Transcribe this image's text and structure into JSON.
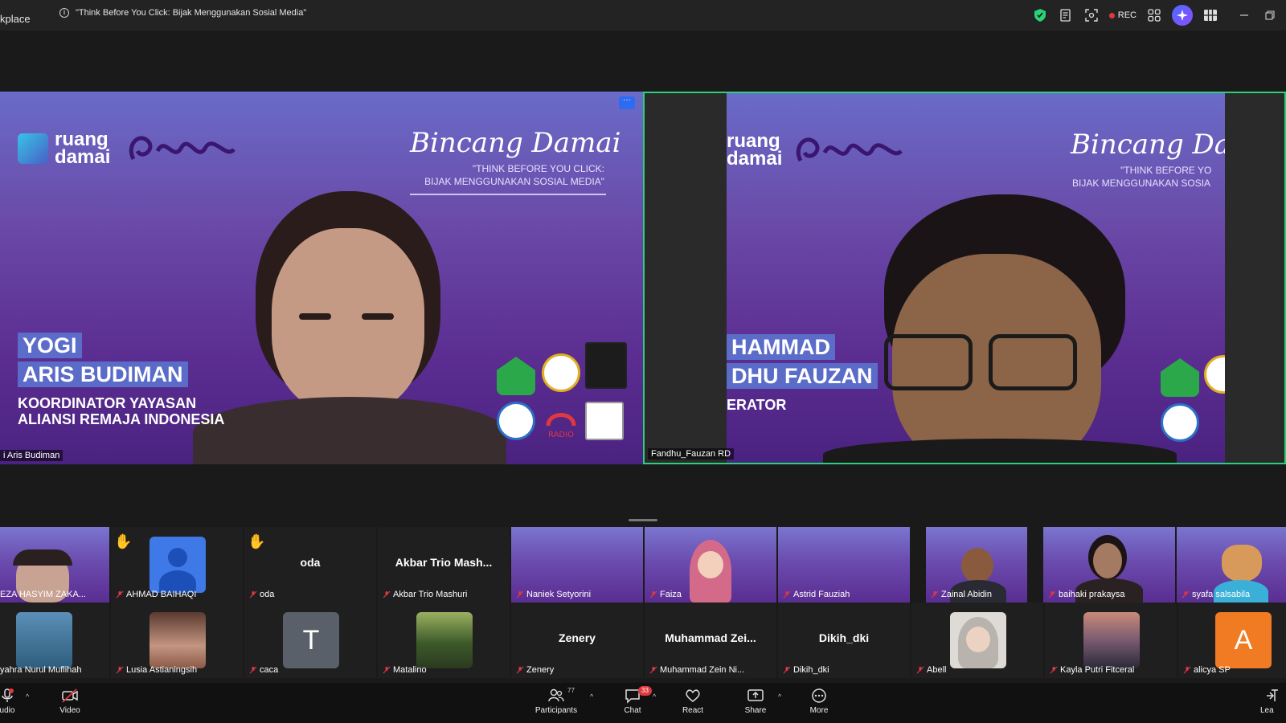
{
  "window": {
    "app_name": "kplace",
    "meeting_title": "\"Think Before You Click: Bijak Menggunakan Sosial Media\"",
    "rec_label": "REC"
  },
  "main": {
    "left_tile": {
      "brand": "ruang damai",
      "script_title": "Bincang Damai",
      "subtitle_line1": "\"THINK BEFORE YOU CLICK:",
      "subtitle_line2": "BIJAK MENGGUNAKAN SOSIAL MEDIA\"",
      "name_line1": "YOGI",
      "name_line2": "ARIS BUDIMAN",
      "role_line1": "KOORDINATOR YAYASAN",
      "role_line2": "ALIANSI REMAJA INDONESIA",
      "participant_label": "i Aris Budiman"
    },
    "right_tile": {
      "brand": "ruang damai",
      "script_title": "Bincang Da",
      "subtitle_line1": "\"THINK BEFORE YO",
      "subtitle_line2": "BIJAK MENGGUNAKAN SOSIA",
      "name_line1": "HAMMAD",
      "name_line2": "DHU FAUZAN",
      "role_line1": "ERATOR",
      "participant_label": "Fandhu_Fauzan RD"
    }
  },
  "gallery": {
    "row1": [
      {
        "label": "EZA HASYIM ZAKA...",
        "kind": "video"
      },
      {
        "label": "AHMAD BAIHAQI",
        "kind": "avatar",
        "hand": true
      },
      {
        "label": "oda",
        "center": "oda",
        "kind": "name",
        "hand": true
      },
      {
        "label": "Akbar Trio Mashuri",
        "center": "Akbar Trio Mash...",
        "kind": "name"
      },
      {
        "label": "Naniek Setyorini",
        "kind": "purple"
      },
      {
        "label": "Faiza",
        "kind": "purple"
      },
      {
        "label": "Astrid Fauziah",
        "kind": "purple"
      },
      {
        "label": "Zainal Abidin",
        "kind": "video"
      },
      {
        "label": "baihaki prakaysa",
        "kind": "purple"
      },
      {
        "label": "syafa salsabila",
        "kind": "purple"
      }
    ],
    "row2": [
      {
        "label": "yahra Nurul Muflihah",
        "kind": "photo"
      },
      {
        "label": "Lusia Astianingsih",
        "kind": "photo"
      },
      {
        "label": "caca",
        "initial": "T",
        "kind": "initial"
      },
      {
        "label": "Matalino",
        "kind": "photo"
      },
      {
        "label": "Zenery",
        "center": "Zenery",
        "kind": "name"
      },
      {
        "label": "Muhammad Zein Ni...",
        "center": "Muhammad Zei...",
        "kind": "name"
      },
      {
        "label": "Dikih_dki",
        "center": "Dikih_dki",
        "kind": "name"
      },
      {
        "label": "Abell",
        "kind": "photo"
      },
      {
        "label": "Kayla Putri Fitceral",
        "kind": "photo"
      },
      {
        "label": "alicya SP",
        "initial": "A",
        "kind": "initial-orange"
      }
    ]
  },
  "toolbar": {
    "audio_label": "udio",
    "video_label": "Video",
    "participants_label": "Participants",
    "participants_count": "77",
    "chat_label": "Chat",
    "chat_badge": "33",
    "react_label": "React",
    "share_label": "Share",
    "more_label": "More",
    "leave_label": "Lea"
  },
  "colors": {
    "active_speaker_border": "#2bd178",
    "rec_dot": "#e0383e",
    "toolbar_bg": "#111111"
  }
}
